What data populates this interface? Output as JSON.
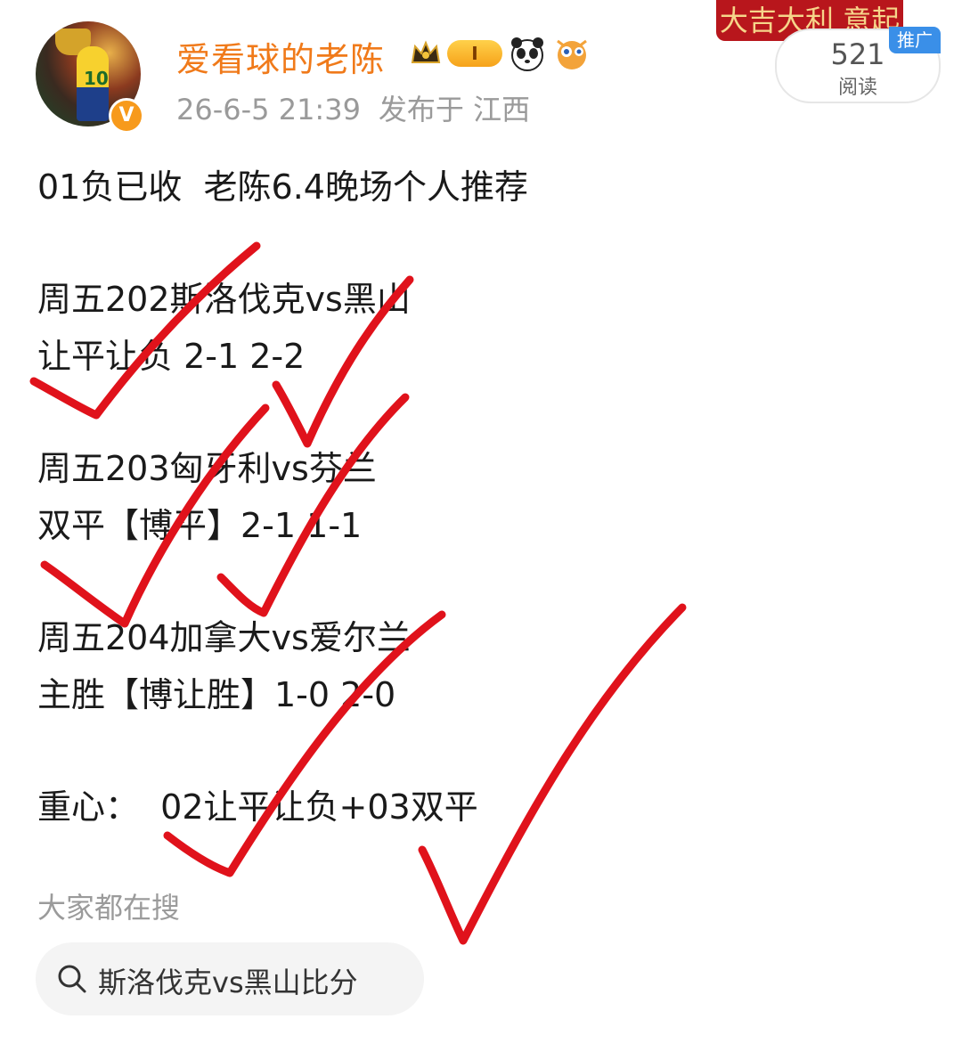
{
  "author": {
    "name": "爱看球的老陈",
    "level": "I",
    "verified": "V",
    "avatar_number": "10"
  },
  "meta": {
    "date": "26-6-5 21:39",
    "location": "发布于 江西"
  },
  "banner": {
    "text": "大吉大利 意起发财"
  },
  "reads": {
    "count": "521",
    "label": "阅读",
    "tag": "推广"
  },
  "post": {
    "lines": [
      "01负已收  老陈6.4晚场个人推荐",
      "",
      "周五202斯洛伐克vs黑山",
      "让平让负 2-1 2-2",
      "",
      "周五203匈牙利vs芬兰",
      "双平【博平】2-1 1-1",
      "",
      "周五204加拿大vs爱尔兰",
      "主胜【博让胜】1-0 2-0",
      "",
      "重心：  02让平让负+03双平"
    ]
  },
  "hot_search": {
    "label": "大家都在搜",
    "query": "斯洛伐克vs黑山比分"
  },
  "colors": {
    "username": "#f07a1a",
    "check_marks": "#e0121b",
    "meta": "#9a9a9a"
  }
}
